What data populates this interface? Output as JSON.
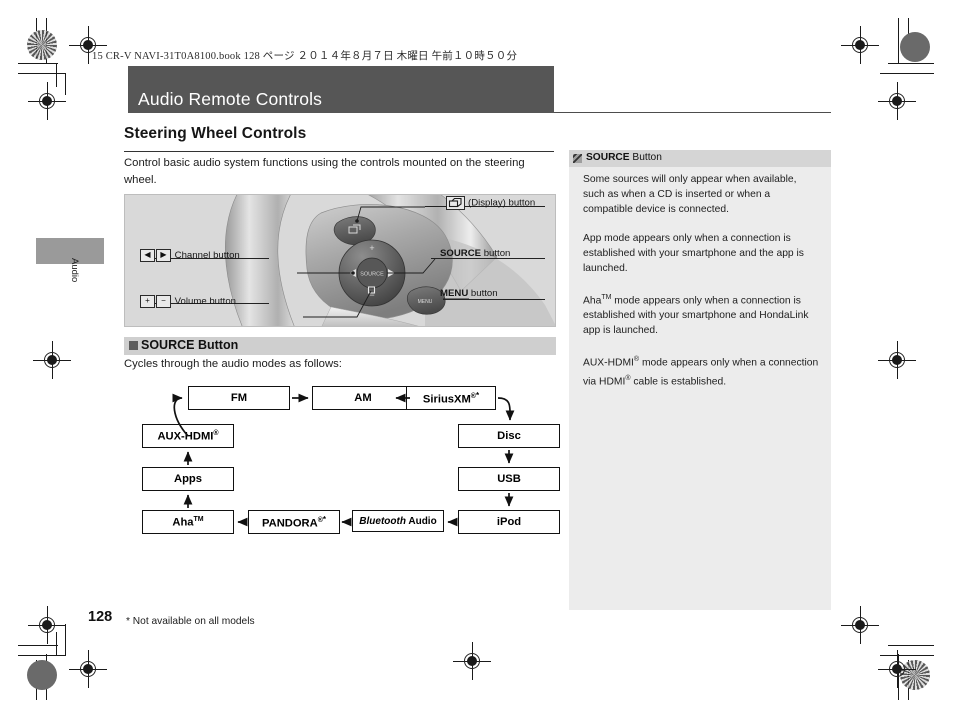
{
  "slug": "15 CR-V NAVI-31T0A8100.book   128 ページ   ２０１４年８月７日   木曜日   午前１０時５０分",
  "chapter": {
    "title": "Audio Remote Controls"
  },
  "tab": {
    "label": "Audio"
  },
  "section": {
    "heading": "Steering Wheel Controls",
    "intro": "Control basic audio system functions using the controls mounted on the steering wheel."
  },
  "illustration": {
    "callouts": {
      "display": "(Display) button",
      "channel": "Channel button",
      "volume": "Volume button",
      "source_bold": "SOURCE",
      "source_rest": " button",
      "menu_bold": "MENU",
      "menu_rest": " button",
      "channel_key_left": "◀",
      "channel_key_right": "▶",
      "volume_key_plus": "+",
      "volume_key_minus": "−"
    }
  },
  "subsection": {
    "title": "SOURCE Button",
    "description": "Cycles through the audio modes as follows:"
  },
  "flow": {
    "boxes": [
      {
        "id": "fm",
        "label": "FM"
      },
      {
        "id": "am",
        "label": "AM"
      },
      {
        "id": "siriusxm",
        "label": "SiriusXM"
      },
      {
        "id": "disc",
        "label": "Disc"
      },
      {
        "id": "usb",
        "label": "USB"
      },
      {
        "id": "ipod",
        "label": "iPod"
      },
      {
        "id": "bluetooth",
        "label_italic": "Bluetooth",
        "label_rest": " Audio"
      },
      {
        "id": "pandora",
        "label": "PANDORA"
      },
      {
        "id": "aha",
        "label": "Aha"
      },
      {
        "id": "apps",
        "label": "Apps"
      },
      {
        "id": "aux-hdmi",
        "label": "AUX-HDMI"
      }
    ]
  },
  "sidebar": {
    "title_bold": "SOURCE",
    "title_rest": " Button",
    "paragraphs": [
      "Some sources will only appear when available, such as when a CD is inserted or when a compatible device is connected.",
      "App mode appears only when a connection is established with your smartphone and the app is launched."
    ],
    "para_aha_pre": "Aha",
    "para_aha_post": " mode appears only when a connection is established with your smartphone and HondaLink app is launched.",
    "para_aux_pre": "AUX-HDMI",
    "para_aux_mid": " mode appears only when a connection via HDMI",
    "para_aux_post": " cable is established."
  },
  "footer": {
    "page_number": "128",
    "footnote": "* Not available on all models"
  },
  "colors": {
    "header_bar": "#565656",
    "subsection_bar": "#cfcfcf",
    "sidebar_bg": "#ececec",
    "sidebar_head": "#d5d5d5",
    "illustration_bg": "#d9d9d9"
  }
}
